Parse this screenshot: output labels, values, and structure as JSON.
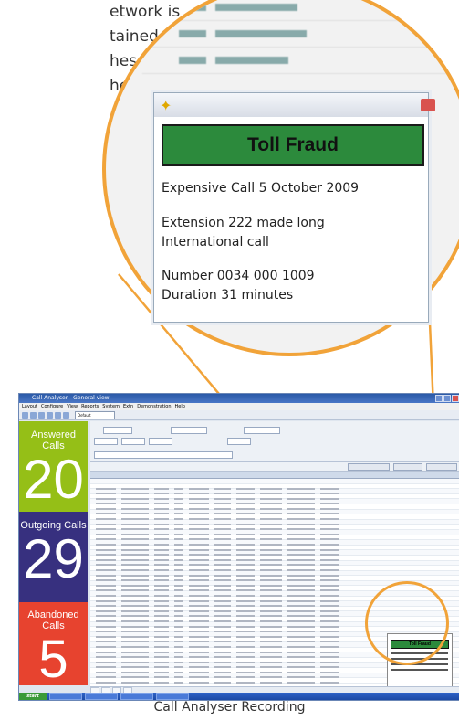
{
  "background_text": [
    "etwork is",
    "tained at",
    "hes for",
    "her"
  ],
  "popup": {
    "banner_title": "Toll Fraud",
    "line1": "Expensive Call 5 October 2009",
    "line2": "Extension 222 made long",
    "line3": "International call",
    "line4": "Number 0034 000 1009",
    "line5": "Duration 31 minutes"
  },
  "app": {
    "window_title": "Call Analyser - General view",
    "menu": [
      "Layout",
      "Configure",
      "View",
      "Reports",
      "System",
      "Extn",
      "Demonstration",
      "Help"
    ],
    "toolbar_select": "Default",
    "panels": [
      {
        "label": "Answered Calls",
        "count": "20",
        "color": "#95bf17"
      },
      {
        "label": "Outgoing Calls",
        "count": "29",
        "color": "#37307f"
      },
      {
        "label": "Abandoned Calls",
        "count": "5",
        "color": "#e7432f"
      }
    ],
    "mini_popup_title": "Toll Fraud",
    "taskbar_start": "start"
  },
  "colors": {
    "accent_orange": "#f1a339",
    "fraud_green": "#2c8a3c"
  },
  "caption": "Call Analyser Recording"
}
